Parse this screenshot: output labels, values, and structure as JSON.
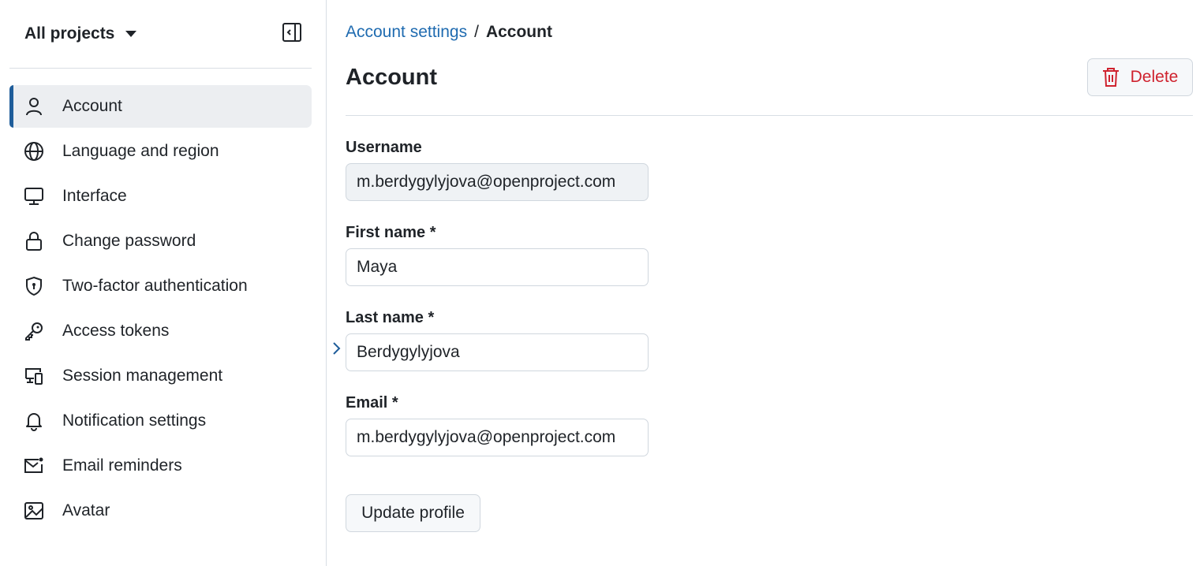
{
  "sidebar": {
    "project_switcher": "All projects",
    "items": [
      {
        "label": "Account",
        "icon": "person-icon",
        "active": true
      },
      {
        "label": "Language and region",
        "icon": "globe-icon",
        "active": false
      },
      {
        "label": "Interface",
        "icon": "monitor-icon",
        "active": false
      },
      {
        "label": "Change password",
        "icon": "lock-icon",
        "active": false
      },
      {
        "label": "Two-factor authentication",
        "icon": "shield-icon",
        "active": false
      },
      {
        "label": "Access tokens",
        "icon": "key-icon",
        "active": false
      },
      {
        "label": "Session management",
        "icon": "devices-icon",
        "active": false
      },
      {
        "label": "Notification settings",
        "icon": "bell-icon",
        "active": false
      },
      {
        "label": "Email reminders",
        "icon": "mail-icon",
        "active": false
      },
      {
        "label": "Avatar",
        "icon": "image-icon",
        "active": false
      }
    ]
  },
  "breadcrumb": {
    "parent": "Account settings",
    "separator": "/",
    "current": "Account"
  },
  "page": {
    "title": "Account",
    "delete_label": "Delete"
  },
  "form": {
    "username": {
      "label": "Username",
      "value": "m.berdygylyjova@openproject.com"
    },
    "first_name": {
      "label": "First name *",
      "value": "Maya"
    },
    "last_name": {
      "label": "Last name *",
      "value": "Berdygylyjova"
    },
    "email": {
      "label": "Email *",
      "value": "m.berdygylyjova@openproject.com"
    },
    "submit_label": "Update profile"
  },
  "colors": {
    "accent": "#1f5d9a",
    "link": "#1f6bb0",
    "danger": "#cf222e",
    "active_bg": "#eceef1"
  }
}
